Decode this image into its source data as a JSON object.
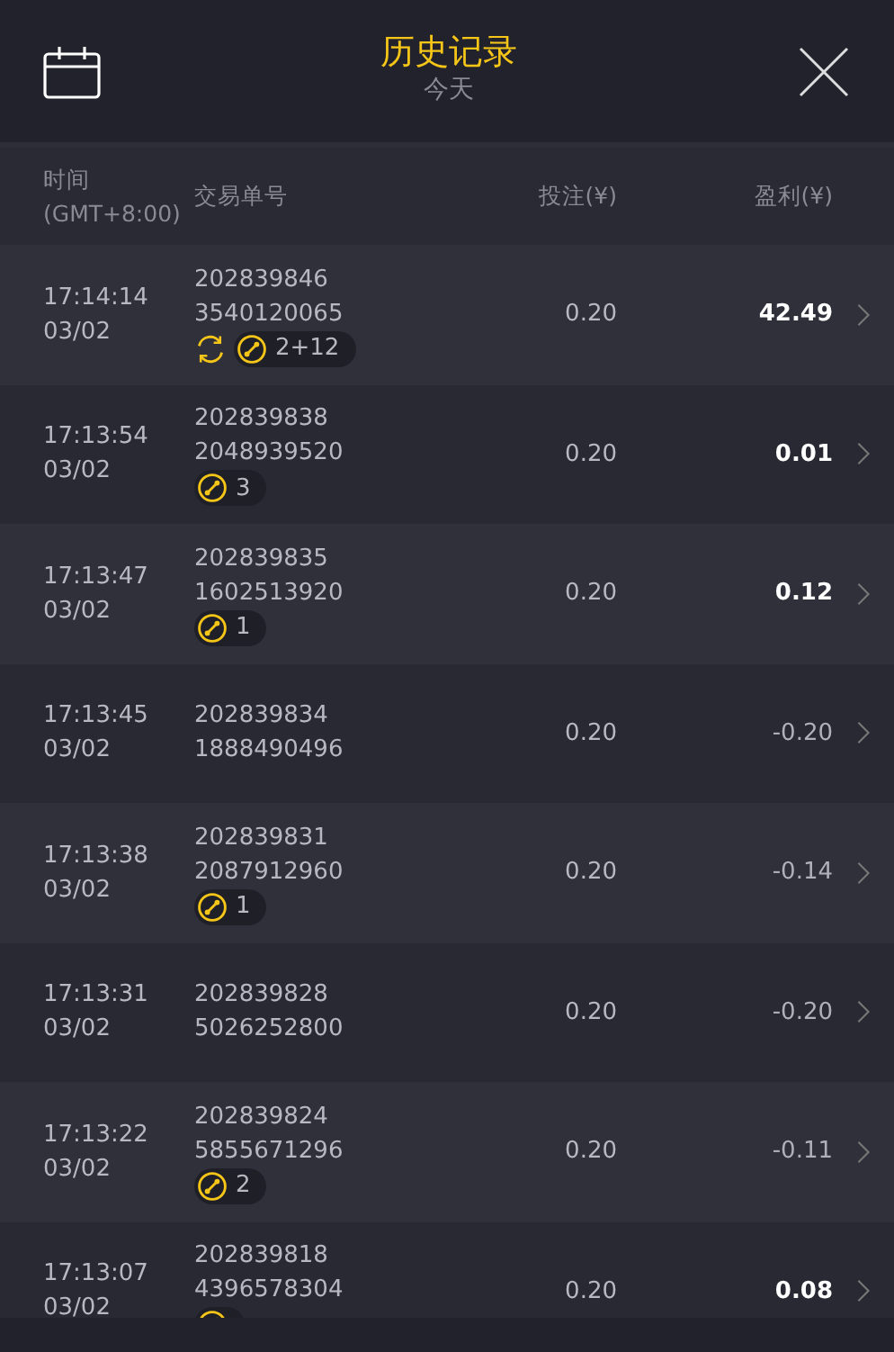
{
  "header": {
    "title": "历史记录",
    "subtitle": "今天"
  },
  "columns": {
    "time": "时间",
    "timezone": "(GMT+8:00)",
    "order": "交易单号",
    "bet": "投注(¥)",
    "profit": "盈利(¥)"
  },
  "rows": [
    {
      "time": "17:14:14",
      "date": "03/02",
      "order_a": "202839846",
      "order_b": "3540120065",
      "bet": "0.20",
      "profit": "42.49",
      "win": true,
      "free_spin": true,
      "bonus": true,
      "bonus_count": "2+12"
    },
    {
      "time": "17:13:54",
      "date": "03/02",
      "order_a": "202839838",
      "order_b": "2048939520",
      "bet": "0.20",
      "profit": "0.01",
      "win": true,
      "free_spin": false,
      "bonus": true,
      "bonus_count": "3"
    },
    {
      "time": "17:13:47",
      "date": "03/02",
      "order_a": "202839835",
      "order_b": "1602513920",
      "bet": "0.20",
      "profit": "0.12",
      "win": true,
      "free_spin": false,
      "bonus": true,
      "bonus_count": "1"
    },
    {
      "time": "17:13:45",
      "date": "03/02",
      "order_a": "202839834",
      "order_b": "1888490496",
      "bet": "0.20",
      "profit": "-0.20",
      "win": false,
      "free_spin": false,
      "bonus": false
    },
    {
      "time": "17:13:38",
      "date": "03/02",
      "order_a": "202839831",
      "order_b": "2087912960",
      "bet": "0.20",
      "profit": "-0.14",
      "win": false,
      "free_spin": false,
      "bonus": true,
      "bonus_count": "1"
    },
    {
      "time": "17:13:31",
      "date": "03/02",
      "order_a": "202839828",
      "order_b": "5026252800",
      "bet": "0.20",
      "profit": "-0.20",
      "win": false,
      "free_spin": false,
      "bonus": false
    },
    {
      "time": "17:13:22",
      "date": "03/02",
      "order_a": "202839824",
      "order_b": "5855671296",
      "bet": "0.20",
      "profit": "-0.11",
      "win": false,
      "free_spin": false,
      "bonus": true,
      "bonus_count": "2"
    },
    {
      "time": "17:13:07",
      "date": "03/02",
      "order_a": "202839818",
      "order_b": "4396578304",
      "bet": "0.20",
      "profit": "0.08",
      "win": true,
      "free_spin": false,
      "bonus": true
    }
  ]
}
